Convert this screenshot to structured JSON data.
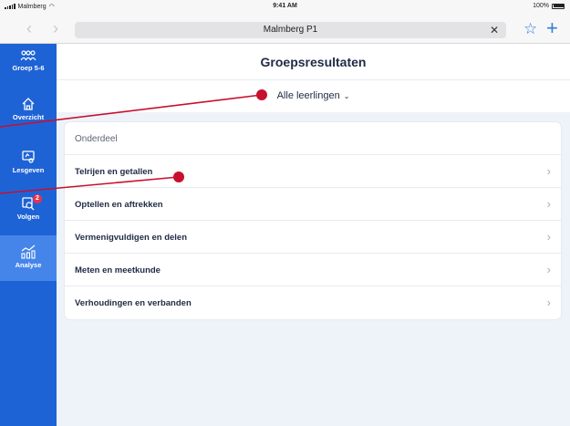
{
  "status": {
    "carrier": "Malmberg",
    "time": "9:41 AM",
    "battery": "100%"
  },
  "browser": {
    "back": "‹",
    "forward": "›",
    "url": "Malmberg P1",
    "clear": "✕",
    "star": "☆",
    "add": "+"
  },
  "sidebar": {
    "items": [
      {
        "label": "Groep 5-6",
        "icon": "group-icon"
      },
      {
        "label": "Overzicht",
        "icon": "home-icon"
      },
      {
        "label": "Lesgeven",
        "icon": "board-icon"
      },
      {
        "label": "Volgen",
        "icon": "follow-icon",
        "badge": "2"
      },
      {
        "label": "Analyse",
        "icon": "chart-icon",
        "active": true
      }
    ]
  },
  "main": {
    "title": "Groepsresultaten",
    "filter": {
      "label": "Alle leerlingen",
      "chevron": "⌄"
    },
    "table": {
      "header": "Onderdeel",
      "rows": [
        "Telrijen en getallen",
        "Optellen en aftrekken",
        "Vermenigvuldigen en delen",
        "Meten en meetkunde",
        "Verhoudingen en verbanden"
      ],
      "arrow": "›"
    }
  },
  "colors": {
    "sidebar": "#1e63d6",
    "active": "#4585ea",
    "annotation": "#c8102e"
  }
}
